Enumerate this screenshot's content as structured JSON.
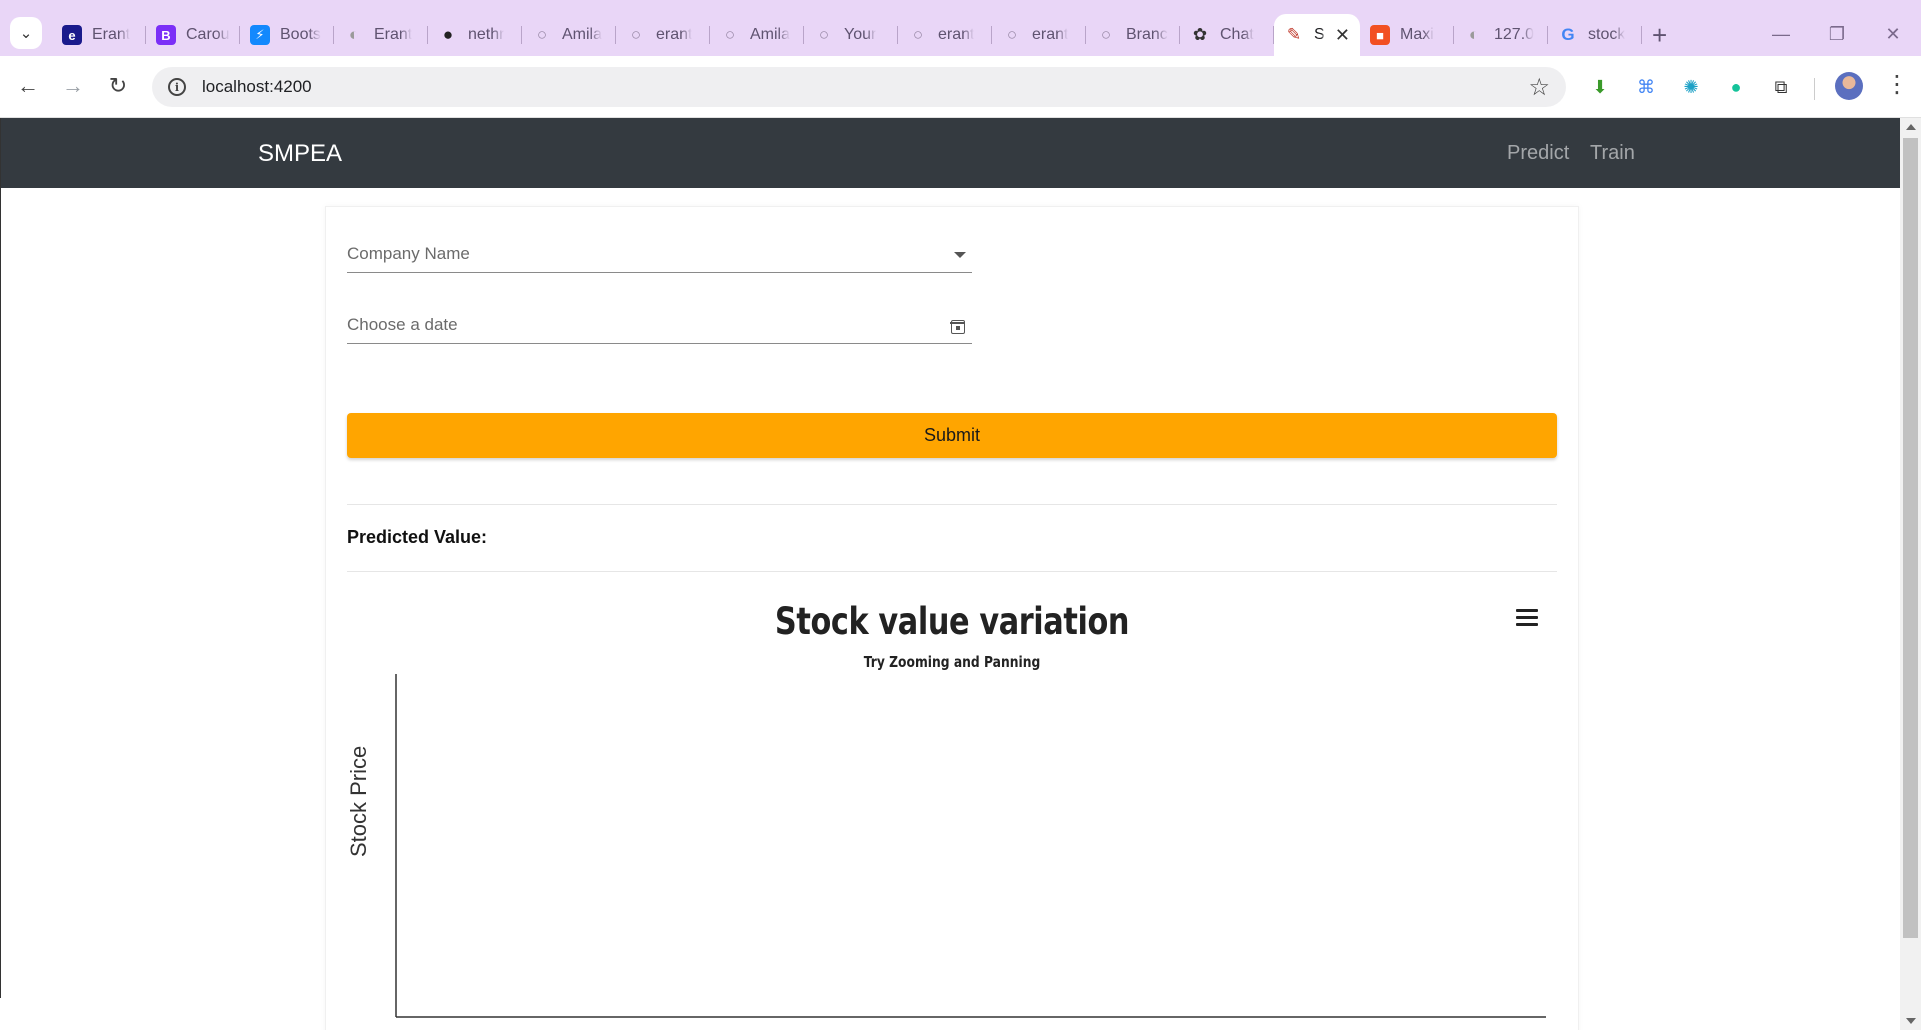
{
  "browser": {
    "tabs": [
      {
        "title": "Erant",
        "favicon": "eyeo-icon",
        "color": "#1a1a8c",
        "glyph": "e"
      },
      {
        "title": "Carou",
        "favicon": "bootstrap-icon",
        "color": "#7b2ff7",
        "glyph": "B"
      },
      {
        "title": "Boots",
        "favicon": "stackblitz-icon",
        "color": "#1389fd",
        "glyph": "⚡"
      },
      {
        "title": "Erant",
        "favicon": "globe-icon",
        "color": "#9a9a9a",
        "glyph": "◐"
      },
      {
        "title": "nethr",
        "favicon": "github-icon",
        "color": "#222222",
        "glyph": "●"
      },
      {
        "title": "Amila",
        "favicon": "github-icon",
        "color": "#9a8aa8",
        "glyph": "○"
      },
      {
        "title": "erant",
        "favicon": "github-icon",
        "color": "#9a8aa8",
        "glyph": "○"
      },
      {
        "title": "Amila",
        "favicon": "github-icon",
        "color": "#9a8aa8",
        "glyph": "○"
      },
      {
        "title": "Your",
        "favicon": "github-icon",
        "color": "#9a8aa8",
        "glyph": "○"
      },
      {
        "title": "erant",
        "favicon": "github-icon",
        "color": "#9a8aa8",
        "glyph": "○"
      },
      {
        "title": "erant",
        "favicon": "github-icon",
        "color": "#9a8aa8",
        "glyph": "○"
      },
      {
        "title": "Branc",
        "favicon": "github-icon",
        "color": "#9a8aa8",
        "glyph": "○"
      },
      {
        "title": "Chat",
        "favicon": "openai-icon",
        "color": "#333333",
        "glyph": "✿"
      },
      {
        "title": "S",
        "favicon": "angular-icon",
        "color": "#ffffff",
        "glyph": "✎",
        "active": true
      },
      {
        "title": "Maxi",
        "favicon": "microsoft-icon",
        "color": "#f25022",
        "glyph": "■"
      },
      {
        "title": "127.0",
        "favicon": "globe-icon",
        "color": "#9a9a9a",
        "glyph": "◐"
      },
      {
        "title": "stock",
        "favicon": "google-icon",
        "color": "#ffffff",
        "glyph": "G"
      }
    ],
    "url": "localhost:4200"
  },
  "app": {
    "brand": "SMPEA",
    "nav": {
      "predict": "Predict",
      "train": "Train"
    }
  },
  "form": {
    "company_placeholder": "Company Name",
    "date_placeholder": "Choose a date",
    "submit_label": "Submit",
    "predicted_label": "Predicted Value:",
    "predicted_value": ""
  },
  "chart_data": {
    "type": "line",
    "title": "Stock value variation",
    "subtitle": "Try Zooming and Panning",
    "ylabel": "Stock Price",
    "xlabel": "",
    "series": [],
    "grid": false
  },
  "colors": {
    "navbar_bg": "#343a40",
    "submit_bg": "#ffa500",
    "tabstrip_bg": "#e9d6f7"
  }
}
